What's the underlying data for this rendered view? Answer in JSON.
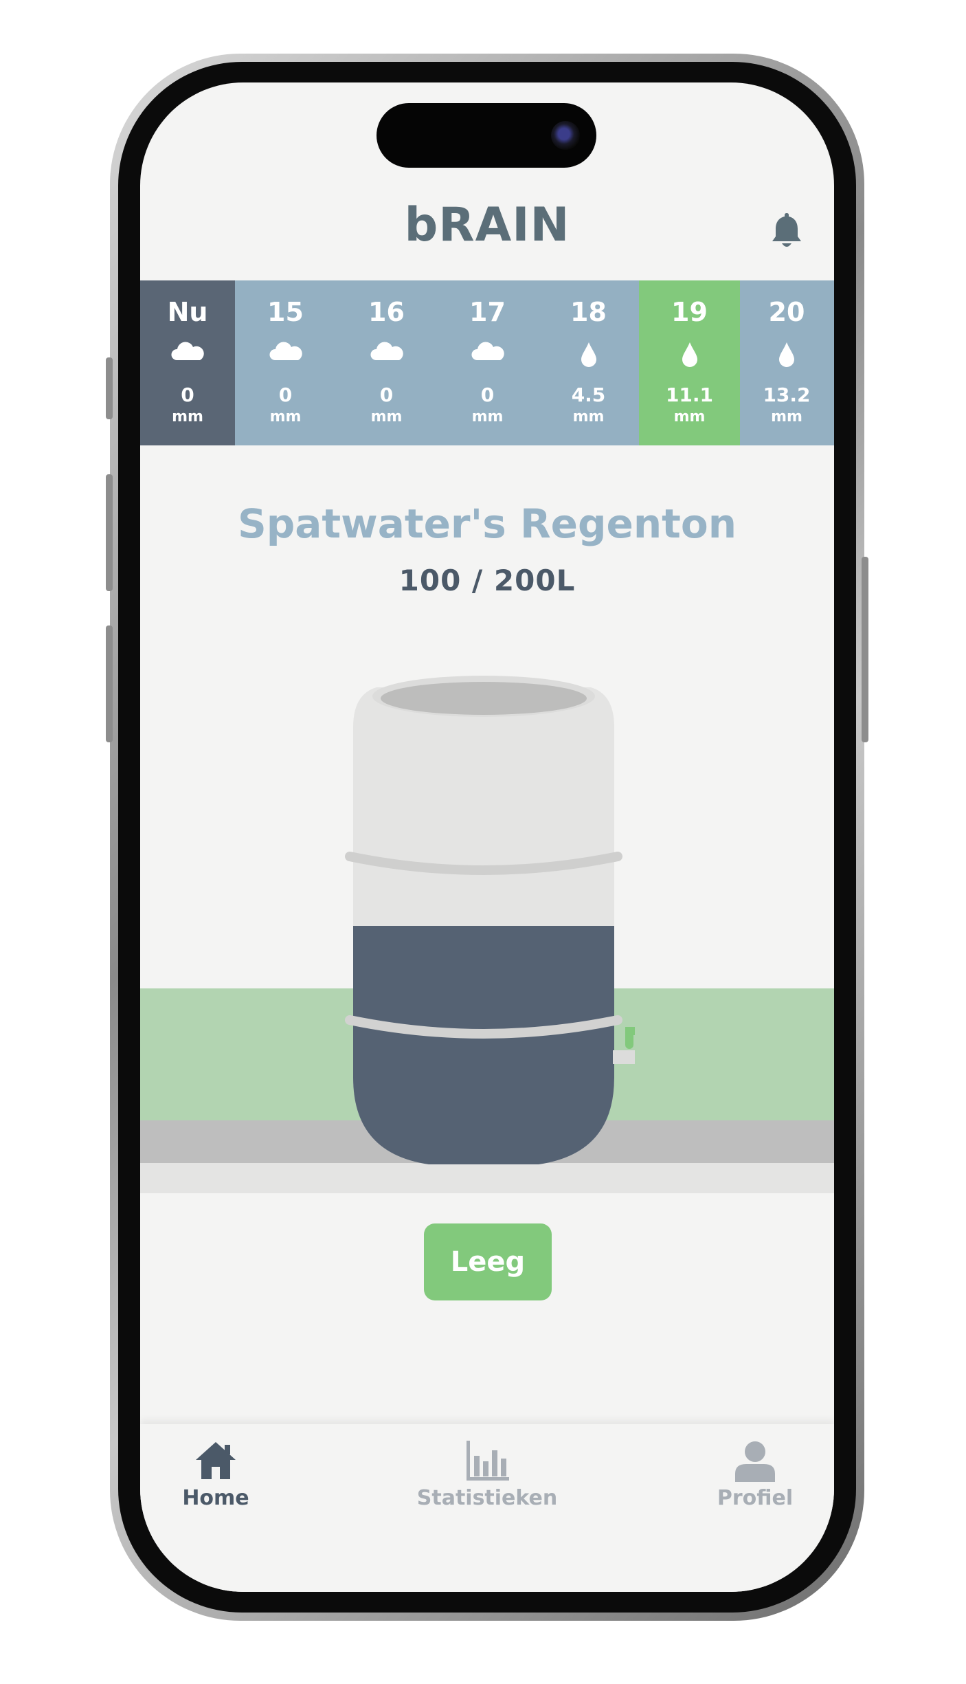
{
  "app": {
    "title": "bRAIN"
  },
  "forecast": [
    {
      "label": "Nu",
      "icon": "cloud-icon",
      "value": "0",
      "unit": "mm",
      "state": "now"
    },
    {
      "label": "15",
      "icon": "cloud-icon",
      "value": "0",
      "unit": "mm",
      "state": "normal"
    },
    {
      "label": "16",
      "icon": "cloud-icon",
      "value": "0",
      "unit": "mm",
      "state": "normal"
    },
    {
      "label": "17",
      "icon": "cloud-icon",
      "value": "0",
      "unit": "mm",
      "state": "normal"
    },
    {
      "label": "18",
      "icon": "raindrop-icon",
      "value": "4.5",
      "unit": "mm",
      "state": "normal"
    },
    {
      "label": "19",
      "icon": "raindrop-icon",
      "value": "11.1",
      "unit": "mm",
      "state": "selected"
    },
    {
      "label": "20",
      "icon": "raindrop-icon",
      "value": "13.2",
      "unit": "mm",
      "state": "normal"
    }
  ],
  "tank": {
    "name": "Spatwater's Regenton",
    "level_text": "100 / 200L",
    "fill_fraction": 0.5
  },
  "actions": {
    "empty_label": "Leeg"
  },
  "tabs": [
    {
      "label": "Home",
      "icon": "home-icon",
      "active": true
    },
    {
      "label": "Statistieken",
      "icon": "bar-chart-icon",
      "active": false
    },
    {
      "label": "Profiel",
      "icon": "user-icon",
      "active": false
    }
  ],
  "colors": {
    "now_bg": "#5a6675",
    "strip_bg": "#94b0c2",
    "selected_bg": "#82c97c",
    "water": "#556273",
    "title_blue": "#97b3c6"
  }
}
